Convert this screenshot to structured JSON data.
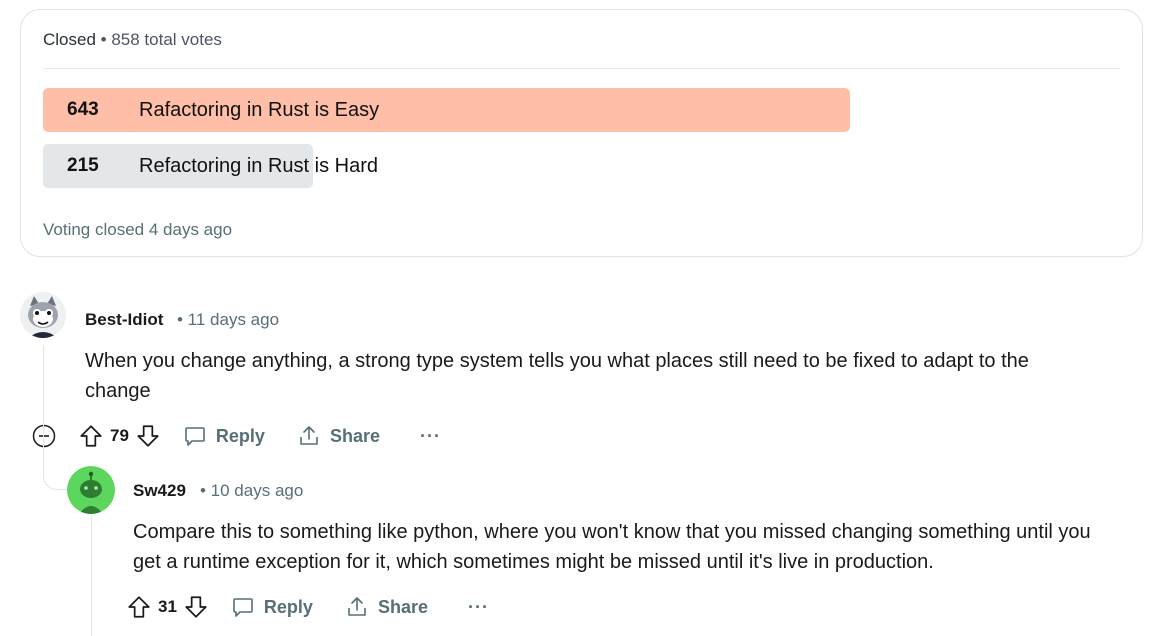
{
  "poll": {
    "status": "Closed",
    "separator": "•",
    "total_votes": "858 total votes",
    "options": [
      {
        "count": "643",
        "label": "Rafactoring in Rust is Easy",
        "fraction": 0.749,
        "color": "#ffbea7"
      },
      {
        "count": "215",
        "label": "Refactoring in Rust is Hard",
        "fraction": 0.251,
        "color": "#e3e7ea"
      }
    ],
    "footer": "Voting closed 4 days ago"
  },
  "comments": [
    {
      "author": "Best-Idiot",
      "meta": "• 11 days ago",
      "body": "When you change anything, a strong type system tells you what places still need to be fixed to adapt to the change",
      "votes": "79",
      "reply_label": "Reply",
      "share_label": "Share",
      "more_label": "···",
      "avatar_icon": "cat-avatar-icon"
    },
    {
      "author": "Sw429",
      "meta": "• 10 days ago",
      "body": "Compare this to something like python, where you won't know that you missed changing something until you get a runtime exception for it, which sometimes might be missed until it's live in production.",
      "votes": "31",
      "reply_label": "Reply",
      "share_label": "Share",
      "more_label": "···",
      "avatar_icon": "snoo-avatar-icon"
    }
  ],
  "colors": {
    "accent_winner": "#ffbea7",
    "accent_loser": "#e3e7ea",
    "muted_text": "#576f76",
    "avatar_green": "#5cd65c"
  }
}
